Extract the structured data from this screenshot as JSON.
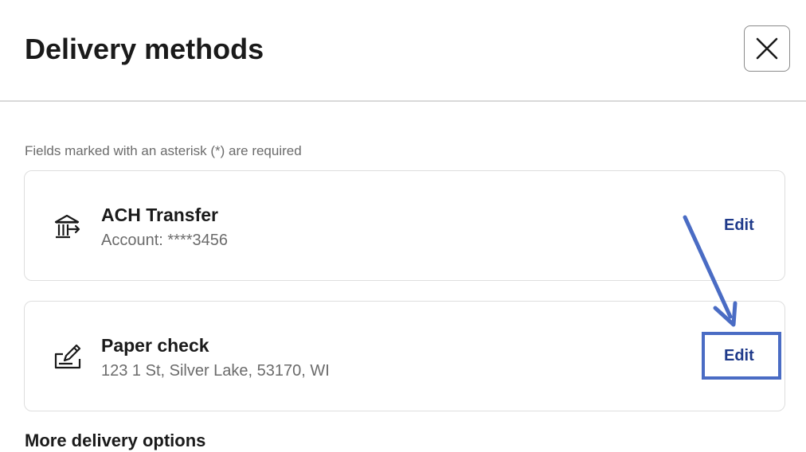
{
  "header": {
    "title": "Delivery methods",
    "close_icon": "close-icon"
  },
  "form": {
    "required_note": "Fields marked with an asterisk (*) are required"
  },
  "methods": [
    {
      "icon": "bank-transfer-icon",
      "title": "ACH Transfer",
      "detail": "Account: ****3456",
      "edit_label": "Edit"
    },
    {
      "icon": "check-sign-icon",
      "title": "Paper check",
      "detail": "123 1 St, Silver Lake, 53170, WI",
      "edit_label": "Edit"
    }
  ],
  "more": {
    "heading": "More delivery options"
  },
  "annotation": {
    "color": "#4a6cc4",
    "arrow_icon": "pointer-arrow-icon"
  }
}
